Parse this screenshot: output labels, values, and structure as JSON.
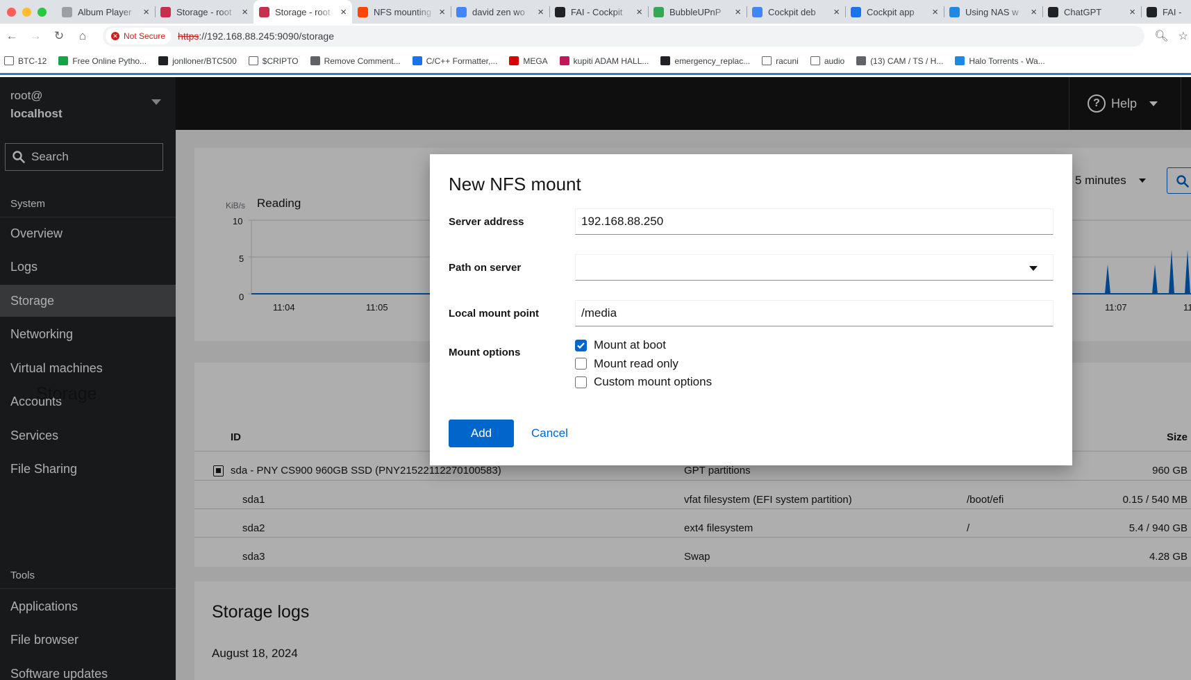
{
  "browser": {
    "tabs": [
      {
        "title": "Album Player",
        "color": "#9aa0a6"
      },
      {
        "title": "Storage - root",
        "color": "#c6304c"
      },
      {
        "title": "Storage - root",
        "color": "#c6304c",
        "active": true
      },
      {
        "title": "NFS mounting",
        "color": "#ff4500"
      },
      {
        "title": "david zen wo",
        "color": "#4285f4"
      },
      {
        "title": "FAI - Cockpit",
        "color": "#202124"
      },
      {
        "title": "BubbleUPnP",
        "color": "#34a853"
      },
      {
        "title": "Cockpit deb",
        "color": "#4285f4"
      },
      {
        "title": "Cockpit app",
        "color": "#1a73e8"
      },
      {
        "title": "Using NAS w",
        "color": "#1e88e5"
      },
      {
        "title": "ChatGPT",
        "color": "#202124"
      },
      {
        "title": "FAI -",
        "color": "#202124"
      }
    ],
    "security_label": "Not Secure",
    "url_scheme": "https",
    "url_rest": "://192.168.88.245:9090/storage",
    "bookmarks": [
      {
        "label": "BTC-12",
        "type": "folder"
      },
      {
        "label": "Free Online Pytho...",
        "type": "icon",
        "color": "#16a34a"
      },
      {
        "label": "jonlloner/BTC500",
        "type": "icon",
        "color": "#202124"
      },
      {
        "label": "$CRIPTO",
        "type": "folder"
      },
      {
        "label": "Remove Comment...",
        "type": "icon",
        "color": "#5f6368"
      },
      {
        "label": "C/C++ Formatter,...",
        "type": "icon",
        "color": "#1a73e8"
      },
      {
        "label": "MEGA",
        "type": "icon",
        "color": "#d90007"
      },
      {
        "label": "kupiti ADAM HALL...",
        "type": "icon",
        "color": "#c2185b"
      },
      {
        "label": "emergency_replac...",
        "type": "icon",
        "color": "#202124"
      },
      {
        "label": "racuni",
        "type": "folder"
      },
      {
        "label": "audio",
        "type": "folder"
      },
      {
        "label": "(13) CAM / TS / H...",
        "type": "icon",
        "color": "#5f6368"
      },
      {
        "label": "Halo Torrents - Wa...",
        "type": "icon",
        "color": "#1e88e5"
      }
    ]
  },
  "sidebar": {
    "user": "root@",
    "host": "localhost",
    "search_label": "Search",
    "section_system": "System",
    "section_tools": "Tools",
    "items": [
      {
        "label": "Overview"
      },
      {
        "label": "Logs"
      },
      {
        "label": "Storage",
        "active": true
      },
      {
        "label": "Networking"
      },
      {
        "label": "Virtual machines"
      },
      {
        "label": "Accounts"
      },
      {
        "label": "Services"
      },
      {
        "label": "File Sharing"
      }
    ],
    "tools": [
      {
        "label": "Applications"
      },
      {
        "label": "File browser"
      },
      {
        "label": "Software updates"
      }
    ]
  },
  "header": {
    "help_label": "Help"
  },
  "chart": {
    "unit": "KiB/s",
    "title": "Reading",
    "y_ticks": [
      "10",
      "5",
      "0"
    ],
    "x_ticks": [
      "11:04",
      "11:05",
      "11:07",
      "11"
    ],
    "range_label": "5 minutes",
    "series_color": "#0066cc"
  },
  "chart_data": {
    "type": "area",
    "title": "Reading",
    "ylabel": "KiB/s",
    "ylim": [
      0,
      10
    ],
    "x_tick_labels": [
      "11:04",
      "11:05",
      "11:07"
    ],
    "spikes_near_end": [
      4,
      4,
      6,
      6
    ]
  },
  "storage": {
    "title": "Storage",
    "col_id": "ID",
    "col_size": "Size",
    "rows": [
      {
        "id": "sda - PNY CS900 960GB SSD (PNY21522112270100583)",
        "type": "GPT partitions",
        "mount": "",
        "size": "960 GB"
      },
      {
        "id": "sda1",
        "type": "vfat filesystem (EFI system partition)",
        "mount": "/boot/efi",
        "size": "0.15 / 540 MB"
      },
      {
        "id": "sda2",
        "type": "ext4 filesystem",
        "mount": "/",
        "size": "5.4 / 940 GB"
      },
      {
        "id": "sda3",
        "type": "Swap",
        "mount": "",
        "size": "4.28 GB"
      }
    ]
  },
  "logs": {
    "title": "Storage logs",
    "date": "August 18, 2024"
  },
  "modal": {
    "title": "New NFS mount",
    "server_label": "Server address",
    "server_value": "192.168.88.250",
    "path_label": "Path on server",
    "path_value": "",
    "mount_point_label": "Local mount point",
    "mount_point_value": "/media",
    "options_label": "Mount options",
    "options": [
      {
        "label": "Mount at boot",
        "checked": true
      },
      {
        "label": "Mount read only",
        "checked": false
      },
      {
        "label": "Custom mount options",
        "checked": false
      }
    ],
    "add_label": "Add",
    "cancel_label": "Cancel"
  }
}
